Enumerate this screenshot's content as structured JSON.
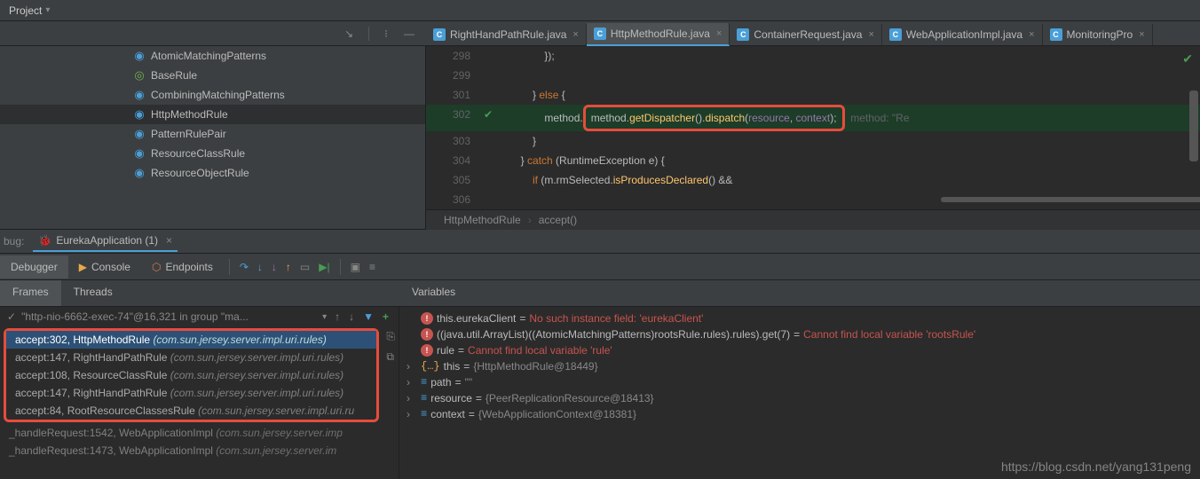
{
  "topBar": {
    "project": "Project"
  },
  "tabs": [
    {
      "name": "RightHandPathRule.java",
      "active": false
    },
    {
      "name": "HttpMethodRule.java",
      "active": true
    },
    {
      "name": "ContainerRequest.java",
      "active": false
    },
    {
      "name": "WebApplicationImpl.java",
      "active": false
    },
    {
      "name": "MonitoringPro",
      "active": false
    }
  ],
  "tree": [
    {
      "name": "AtomicMatchingPatterns",
      "icon": "class"
    },
    {
      "name": "BaseRule",
      "icon": "abstract"
    },
    {
      "name": "CombiningMatchingPatterns",
      "icon": "class"
    },
    {
      "name": "HttpMethodRule",
      "icon": "class",
      "selected": true
    },
    {
      "name": "PatternRulePair",
      "icon": "class"
    },
    {
      "name": "ResourceClassRule",
      "icon": "class"
    },
    {
      "name": "ResourceObjectRule",
      "icon": "class"
    }
  ],
  "code": {
    "l298": "                });",
    "l299": "",
    "l301_a": "            } ",
    "l301_b": "else",
    "l301_c": " {",
    "l302_a": "                method.",
    "l302_b": "getDispatcher",
    "l302_c": "().",
    "l302_d": "dispatch",
    "l302_e": "(",
    "l302_f": "resource",
    "l302_g": ", ",
    "l302_h": "context",
    "l302_i": ");",
    "l302_hint": "  method: \"Re",
    "l303": "            }",
    "l304_a": "        } ",
    "l304_b": "catch",
    "l304_c": " (RuntimeException e) {",
    "l305_a": "            ",
    "l305_b": "if",
    "l305_c": " (m.rmSelected.",
    "l305_d": "isProducesDeclared",
    "l305_e": "() &&",
    "l306": ""
  },
  "lineNumbers": {
    "l298": "298",
    "l299": "299",
    "l301": "301",
    "l302": "302",
    "l303": "303",
    "l304": "304",
    "l305": "305",
    "l306": "306"
  },
  "breadcrumb": {
    "a": "HttpMethodRule",
    "b": "accept()"
  },
  "debugHeader": {
    "label": "bug:",
    "runConfig": "EurekaApplication (1)"
  },
  "debugTabs": {
    "debugger": "Debugger",
    "console": "Console",
    "endpoints": "Endpoints"
  },
  "subTabs": {
    "frames": "Frames",
    "threads": "Threads",
    "variables": "Variables"
  },
  "thread": "\"http-nio-6662-exec-74\"@16,321 in group \"ma...",
  "frames": [
    {
      "text": "accept:302, HttpMethodRule ",
      "pkg": "(com.sun.jersey.server.impl.uri.rules)",
      "sel": true
    },
    {
      "text": "accept:147, RightHandPathRule ",
      "pkg": "(com.sun.jersey.server.impl.uri.rules)"
    },
    {
      "text": "accept:108, ResourceClassRule ",
      "pkg": "(com.sun.jersey.server.impl.uri.rules)"
    },
    {
      "text": "accept:147, RightHandPathRule ",
      "pkg": "(com.sun.jersey.server.impl.uri.rules)"
    },
    {
      "text": "accept:84, RootResourceClassesRule ",
      "pkg": "(com.sun.jersey.server.impl.uri.ru"
    }
  ],
  "framesAfter": [
    {
      "text": "_handleRequest:1542, WebApplicationImpl ",
      "pkg": "(com.sun.jersey.server.imp"
    },
    {
      "text": "_handleRequest:1473, WebApplicationImpl ",
      "pkg": "(com.sun.jersey.server.im"
    }
  ],
  "vars": [
    {
      "type": "err",
      "name": "this.eurekaClient",
      "eq": "=",
      "val": "No such instance field: 'eurekaClient'",
      "err": true
    },
    {
      "type": "err",
      "name": "((java.util.ArrayList)((AtomicMatchingPatterns)rootsRule.rules).rules).get(7)",
      "eq": "=",
      "val": "Cannot find local variable 'rootsRule'",
      "err": true
    },
    {
      "type": "err",
      "name": "rule",
      "eq": "=",
      "val": "Cannot find local variable 'rule'",
      "err": true
    },
    {
      "type": "braces",
      "name": "this",
      "eq": "=",
      "val": "{HttpMethodRule@18449}",
      "expandable": true
    },
    {
      "type": "path",
      "name": "path",
      "eq": "=",
      "val": "\"\"",
      "expandable": true
    },
    {
      "type": "path",
      "name": "resource",
      "eq": "=",
      "val": "{PeerReplicationResource@18413}",
      "expandable": true
    },
    {
      "type": "path",
      "name": "context",
      "eq": "=",
      "val": "{WebApplicationContext@18381}",
      "expandable": true
    }
  ],
  "watermark": "https://blog.csdn.net/yang131peng"
}
